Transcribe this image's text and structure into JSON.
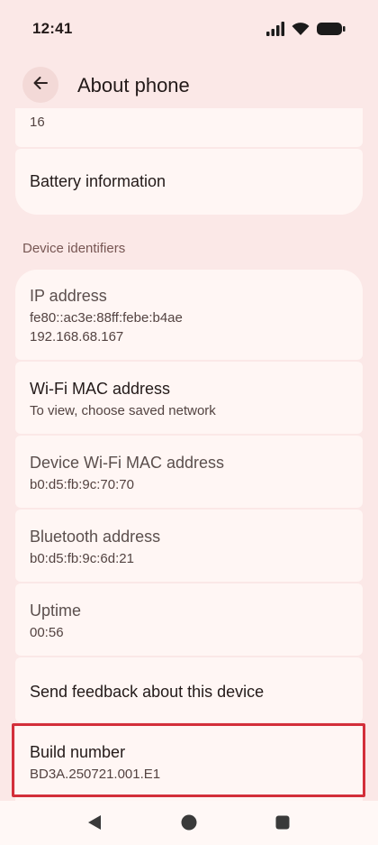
{
  "status_bar": {
    "time": "12:41",
    "icons": [
      "signal-icon",
      "wifi-icon",
      "battery-icon"
    ]
  },
  "app_bar": {
    "back_icon": "arrow-back-icon",
    "title": "About phone"
  },
  "items": {
    "android_version_value": "16",
    "battery_information": "Battery information",
    "section_device_identifiers": "Device identifiers",
    "ip_address_title": "IP address",
    "ip_address_line1": "fe80::ac3e:88ff:febe:b4ae",
    "ip_address_line2": "192.168.68.167",
    "wifi_mac_title": "Wi-Fi MAC address",
    "wifi_mac_sub": "To view, choose saved network",
    "device_wifi_mac_title": "Device Wi-Fi MAC address",
    "device_wifi_mac_value": "b0:d5:fb:9c:70:70",
    "bluetooth_title": "Bluetooth address",
    "bluetooth_value": "b0:d5:fb:9c:6d:21",
    "uptime_title": "Uptime",
    "uptime_value": "00:56",
    "feedback_title": "Send feedback about this device",
    "build_number_title": "Build number",
    "build_number_value": "BD3A.250721.001.E1"
  },
  "nav_bar": {
    "back": "nav-back-icon",
    "home": "nav-home-icon",
    "recents": "nav-recents-icon"
  },
  "colors": {
    "background": "#fbe8e7",
    "card": "#fff6f4",
    "highlight": "#d32f3a",
    "section_header": "#775653"
  }
}
